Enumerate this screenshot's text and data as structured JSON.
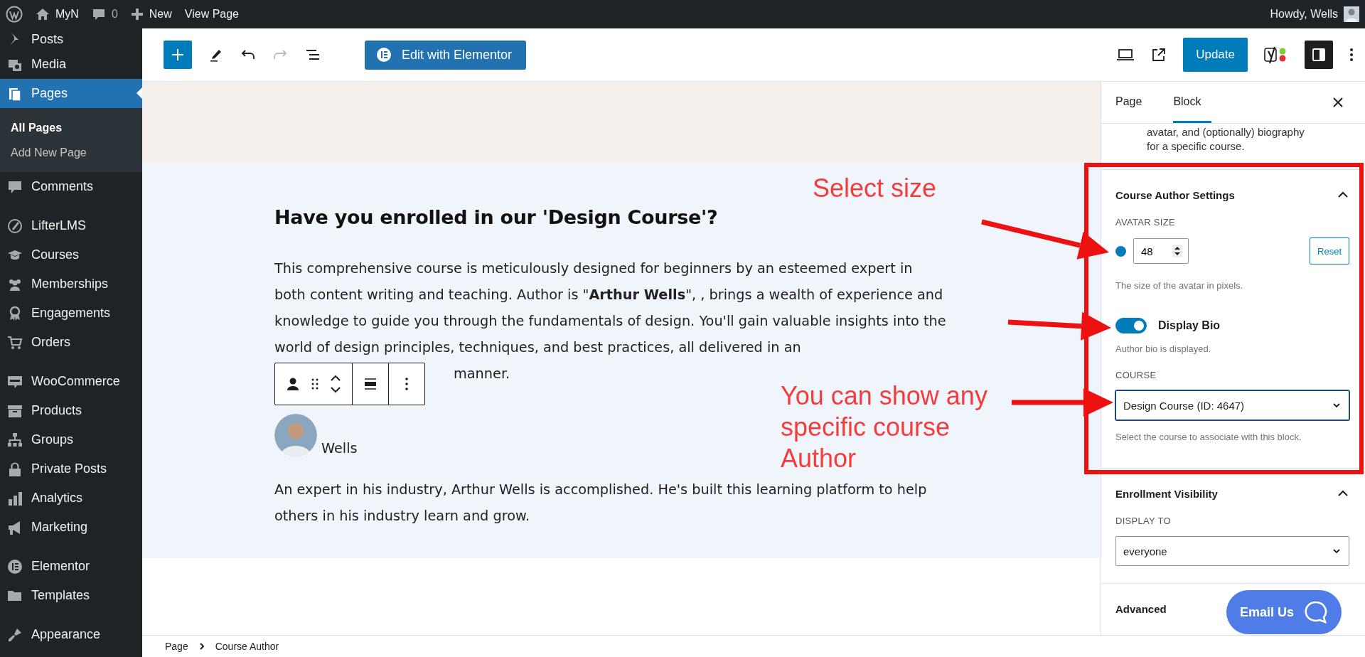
{
  "admin_bar": {
    "site": "MyN",
    "comments": "0",
    "new": "New",
    "view": "View Page",
    "greeting": "Howdy, Wells"
  },
  "sidebar": {
    "groups": [
      {
        "items": [
          {
            "label": "Posts",
            "selected": false
          },
          {
            "label": "Media",
            "selected": false
          },
          {
            "label": "Pages",
            "selected": true,
            "children": [
              {
                "label": "All Pages",
                "selected": true
              },
              {
                "label": "Add New Page",
                "selected": false
              }
            ]
          },
          {
            "label": "Comments",
            "selected": false
          }
        ]
      },
      {
        "items": [
          {
            "label": "LifterLMS",
            "selected": false
          },
          {
            "label": "Courses",
            "selected": false
          },
          {
            "label": "Memberships",
            "selected": false
          },
          {
            "label": "Engagements",
            "selected": false
          },
          {
            "label": "Orders",
            "selected": false
          }
        ]
      },
      {
        "items": [
          {
            "label": "WooCommerce",
            "selected": false
          },
          {
            "label": "Products",
            "selected": false
          },
          {
            "label": "Groups",
            "selected": false
          },
          {
            "label": "Private Posts",
            "selected": false
          },
          {
            "label": "Analytics",
            "selected": false
          },
          {
            "label": "Marketing",
            "selected": false
          }
        ]
      },
      {
        "items": [
          {
            "label": "Elementor",
            "selected": false
          },
          {
            "label": "Templates",
            "selected": false
          }
        ]
      },
      {
        "items": [
          {
            "label": "Appearance",
            "selected": false
          }
        ]
      }
    ]
  },
  "toolbar": {
    "undo_disabled": false,
    "redo_disabled": true,
    "elementor": "Edit with Elementor",
    "update": "Update",
    "settings_on": true
  },
  "content": {
    "heading": "Have you enrolled in our 'Design Course'?",
    "paragraph": "This comprehensive course is meticulously designed for beginners by an esteemed expert in both content writing and teaching. Author is \"**Arthur Wells**\", , brings a wealth of experience and knowledge to guide you through the fundamentals of design. You'll gain valuable insights into the world of design principles, techniques, and best practices, all delivered in an",
    "paragraph_end": "manner.",
    "author": {
      "name": "Wells"
    },
    "bio": "An expert in his industry, Arthur Wells is accomplished. He's built this learning platform to help others in his industry learn and grow."
  },
  "panel": {
    "tabs": [
      {
        "label": "Page",
        "selected": false
      },
      {
        "label": "Block",
        "selected": true
      }
    ],
    "description": "avatar, and (optionally) biography for a specific course.",
    "sections": [
      {
        "title": "Course Author Settings",
        "expanded": true,
        "fields": [
          {
            "kind": "number",
            "label": "AVATAR SIZE",
            "value": "48",
            "reset": "Reset",
            "help": "The size of the avatar in pixels."
          },
          {
            "kind": "toggle",
            "label": "Display Bio",
            "on": true,
            "help": "Author bio is displayed."
          },
          {
            "kind": "select",
            "label": "COURSE",
            "value": "Design Course (ID: 4647)",
            "help": "Select the course to associate with this block."
          }
        ]
      },
      {
        "title": "Enrollment Visibility",
        "expanded": true,
        "fields": [
          {
            "kind": "select",
            "label": "DISPLAY TO",
            "value": "everyone"
          }
        ]
      },
      {
        "title": "Advanced",
        "expanded": false
      }
    ]
  },
  "breadcrumb": [
    "Page",
    "Course Author"
  ],
  "chat_button": "Email Us",
  "annotations": [
    "Select size",
    "You can show any specific course Author"
  ]
}
